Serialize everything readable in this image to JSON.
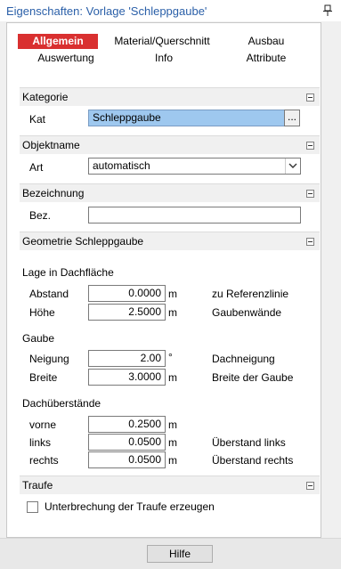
{
  "window": {
    "title": "Eigenschaften: Vorlage 'Schleppgaube'"
  },
  "tabs": [
    {
      "label": "Allgemein",
      "active": true
    },
    {
      "label": "Material/Querschnitt",
      "active": false
    },
    {
      "label": "Ausbau",
      "active": false
    },
    {
      "label": "Auswertung",
      "active": false
    },
    {
      "label": "Info",
      "active": false
    },
    {
      "label": "Attribute",
      "active": false
    }
  ],
  "kategorie": {
    "header": "Kategorie",
    "label": "Kat",
    "value": "Schleppgaube",
    "browse": "..."
  },
  "objektname": {
    "header": "Objektname",
    "label": "Art",
    "value": "automatisch"
  },
  "bezeichnung": {
    "header": "Bezeichnung",
    "label": "Bez.",
    "value": ""
  },
  "geometrie": {
    "header": "Geometrie Schleppgaube",
    "lage": {
      "title": "Lage in Dachfläche",
      "abstand": {
        "label": "Abstand",
        "value": "0.0000",
        "unit": "m",
        "desc": "zu Referenzlinie"
      },
      "hoehe": {
        "label": "Höhe",
        "value": "2.5000",
        "unit": "m",
        "desc": "Gaubenwände"
      }
    },
    "gaube": {
      "title": "Gaube",
      "neigung": {
        "label": "Neigung",
        "value": "2.00",
        "unit": "°",
        "desc": "Dachneigung"
      },
      "breite": {
        "label": "Breite",
        "value": "3.0000",
        "unit": "m",
        "desc": "Breite der Gaube"
      }
    },
    "ueberstaende": {
      "title": "Dachüberstände",
      "vorne": {
        "label": "vorne",
        "value": "0.2500",
        "unit": "m",
        "desc": ""
      },
      "links": {
        "label": "links",
        "value": "0.0500",
        "unit": "m",
        "desc": "Überstand links"
      },
      "rechts": {
        "label": "rechts",
        "value": "0.0500",
        "unit": "m",
        "desc": "Überstand rechts"
      }
    }
  },
  "traufe": {
    "header": "Traufe",
    "checkbox_label": "Unterbrechung der Traufe erzeugen",
    "checked": false
  },
  "footer": {
    "help_label": "Hilfe"
  }
}
